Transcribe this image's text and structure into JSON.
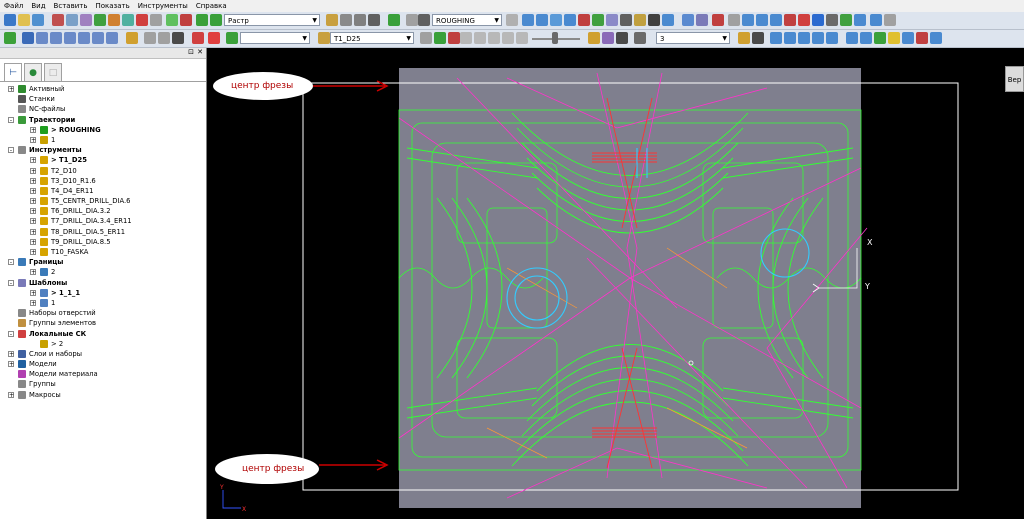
{
  "menu": [
    "Файл",
    "Вид",
    "Вставить",
    "Показать",
    "Инструменты",
    "Справка"
  ],
  "toolbar1": {
    "shading_mode": "Растр",
    "toolpath_select": "ROUGHING"
  },
  "toolbar2": {
    "tool_select": "T1_D25",
    "step_value": "3"
  },
  "tree": [
    {
      "label": "Активный",
      "level": 0,
      "exp": "+",
      "icon": "#2e8b2e",
      "bold": false
    },
    {
      "label": "Станки",
      "level": 0,
      "exp": "",
      "icon": "#555555",
      "bold": false
    },
    {
      "label": "NC-файлы",
      "level": 0,
      "exp": "",
      "icon": "#888888",
      "bold": false
    },
    {
      "label": "Траектории",
      "level": 0,
      "exp": "-",
      "icon": "#3a9a3a",
      "bold": true
    },
    {
      "label": "> ROUGHING",
      "level": 1,
      "exp": "+",
      "icon": "#1e9e1e",
      "bold": true
    },
    {
      "label": "1",
      "level": 1,
      "exp": "+",
      "icon": "#c8a000",
      "bold": false
    },
    {
      "label": "Инструменты",
      "level": 0,
      "exp": "-",
      "icon": "#888888",
      "bold": true
    },
    {
      "label": "> T1_D25",
      "level": 1,
      "exp": "+",
      "icon": "#d6a400",
      "bold": true
    },
    {
      "label": "T2_D10",
      "level": 1,
      "exp": "+",
      "icon": "#d6a400",
      "bold": false
    },
    {
      "label": "T3_D10_R1.6",
      "level": 1,
      "exp": "+",
      "icon": "#d6a400",
      "bold": false
    },
    {
      "label": "T4_D4_ER11",
      "level": 1,
      "exp": "+",
      "icon": "#d6a400",
      "bold": false
    },
    {
      "label": "T5_CENTR_DRILL_DIA.6",
      "level": 1,
      "exp": "+",
      "icon": "#d6a400",
      "bold": false
    },
    {
      "label": "T6_DRILL_DIA.3.2",
      "level": 1,
      "exp": "+",
      "icon": "#d6a400",
      "bold": false
    },
    {
      "label": "T7_DRILL_DIA.3.4_ER11",
      "level": 1,
      "exp": "+",
      "icon": "#d6a400",
      "bold": false
    },
    {
      "label": "T8_DRILL_DIA.5_ER11",
      "level": 1,
      "exp": "+",
      "icon": "#d6a400",
      "bold": false
    },
    {
      "label": "T9_DRILL_DIA.8.5",
      "level": 1,
      "exp": "+",
      "icon": "#d6a400",
      "bold": false
    },
    {
      "label": "T10_FASKA",
      "level": 1,
      "exp": "+",
      "icon": "#d6a400",
      "bold": false
    },
    {
      "label": "Границы",
      "level": 0,
      "exp": "-",
      "icon": "#3a7ab8",
      "bold": true
    },
    {
      "label": "2",
      "level": 1,
      "exp": "+",
      "icon": "#3a7ab8",
      "bold": false
    },
    {
      "label": "Шаблоны",
      "level": 0,
      "exp": "-",
      "icon": "#7a7ab8",
      "bold": true
    },
    {
      "label": "> 1_1_1",
      "level": 1,
      "exp": "+",
      "icon": "#5080c0",
      "bold": true
    },
    {
      "label": "1",
      "level": 1,
      "exp": "+",
      "icon": "#5080c0",
      "bold": false
    },
    {
      "label": "Наборы отверстий",
      "level": 0,
      "exp": "",
      "icon": "#888888",
      "bold": false
    },
    {
      "label": "Группы элементов",
      "level": 0,
      "exp": "",
      "icon": "#c09040",
      "bold": false
    },
    {
      "label": "Локальные СК",
      "level": 0,
      "exp": "-",
      "icon": "#d04040",
      "bold": true
    },
    {
      "label": "> 2",
      "level": 1,
      "exp": "",
      "icon": "#c8a000",
      "bold": false
    },
    {
      "label": "Слои и наборы",
      "level": 0,
      "exp": "+",
      "icon": "#4060a0",
      "bold": false
    },
    {
      "label": "Модели",
      "level": 0,
      "exp": "+",
      "icon": "#2060a0",
      "bold": false
    },
    {
      "label": "Модели материала",
      "level": 0,
      "exp": "",
      "icon": "#b040b0",
      "bold": false
    },
    {
      "label": "Группы",
      "level": 0,
      "exp": "",
      "icon": "#888888",
      "bold": false
    },
    {
      "label": "Макросы",
      "level": 0,
      "exp": "+",
      "icon": "#888888",
      "bold": false
    }
  ],
  "viewport": {
    "annotation_top": "центр фрезы",
    "annotation_bottom": "центр фрезы",
    "axis_x": "X",
    "axis_y": "Y",
    "origin_x": "X",
    "origin_y": "Y",
    "view_button": "Вер",
    "toolpath_colors": {
      "roughing": "#33ff33",
      "rapids": "#ff33cc",
      "leadin": "#ff3333",
      "boundary": "#33ccff",
      "stock": "#8a8a9a"
    }
  }
}
